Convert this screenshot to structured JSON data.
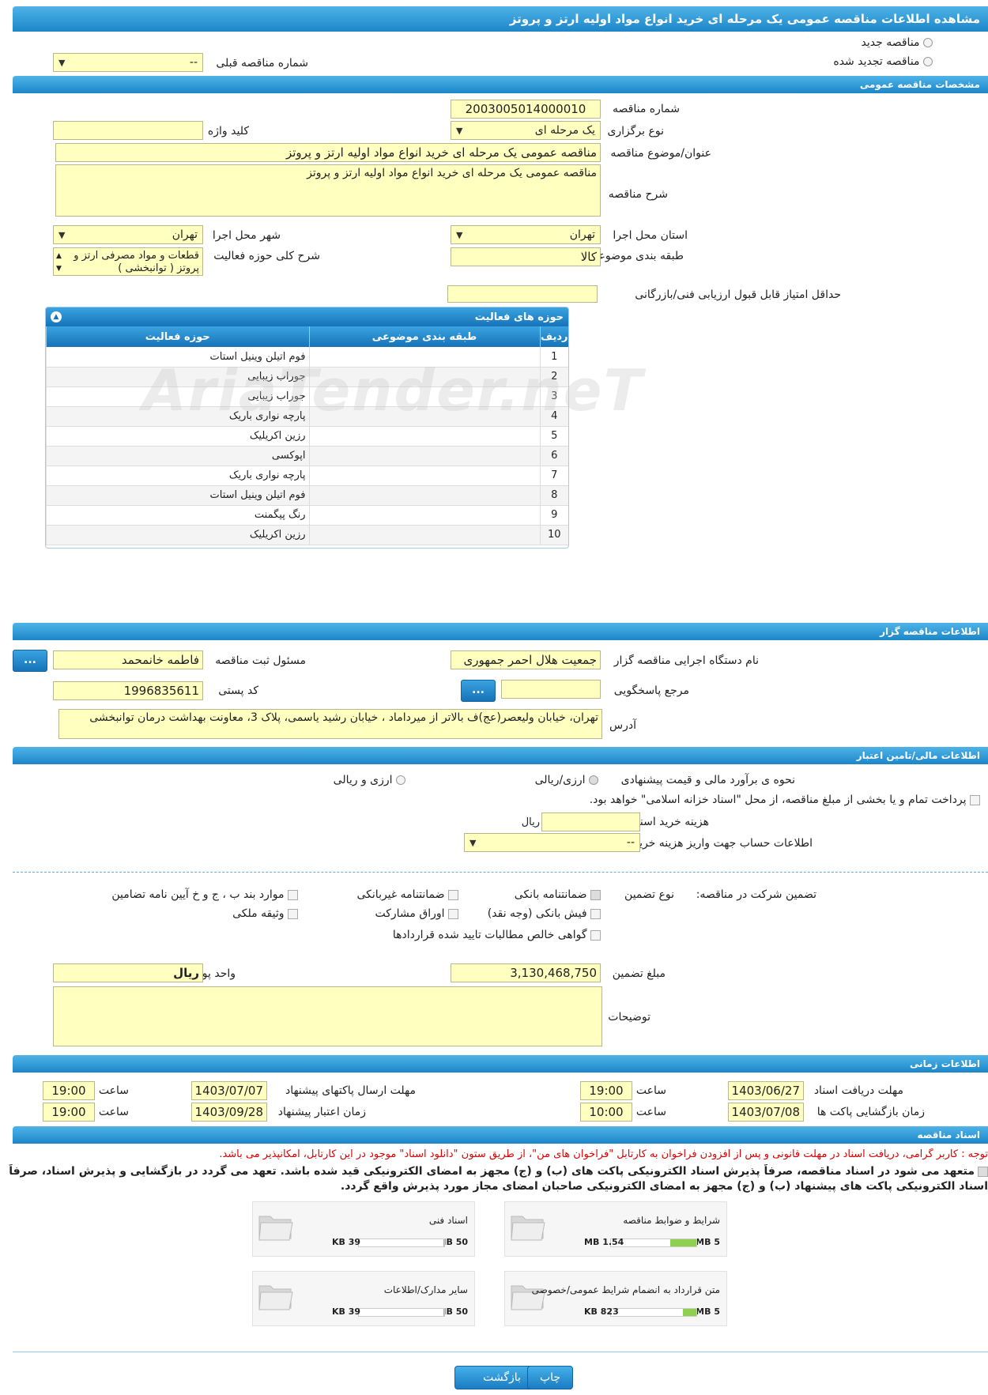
{
  "header": {
    "title": "مشاهده اطلاعات مناقصه عمومی یک مرحله ای خرید انواع مواد اولیه ارتز و پروتز"
  },
  "top": {
    "new_tender": "مناقصه جدید",
    "renewed_tender": "مناقصه تجدید شده",
    "prev_number_label": "شماره مناقصه قبلی",
    "prev_number_value": "--"
  },
  "general": {
    "section_title": "مشخصات مناقصه عمومی",
    "number_label": "شماره مناقصه",
    "number_value": "2003005014000010",
    "type_label": "نوع برگزاری",
    "type_value": "یک مرحله ای",
    "keyword_label": "کلید واژه",
    "keyword_value": "",
    "subject_label": "عنوان/موضوع مناقصه",
    "subject_value": "مناقصه عمومی یک مرحله ای خرید انواع مواد اولیه ارتز و پروتز",
    "desc_label": "شرح مناقصه",
    "desc_value": "مناقصه عمومی یک مرحله ای خرید انواع مواد اولیه ارتز و پروتز",
    "province_label": "استان محل اجرا",
    "province_value": "تهران",
    "city_label": "شهر محل اجرا",
    "city_value": "تهران",
    "category_label": "طبقه بندی موضوعی",
    "category_value": "کالا",
    "scope_label": "شرح کلی حوزه فعالیت",
    "scope_value": "قطعات و مواد مصرفی ارتز و پروتز ( توانبخشی )",
    "min_score_label": "حداقل امتیاز قابل قبول ارزیابی فنی/بازرگانی",
    "min_score_value": ""
  },
  "activities": {
    "title": "حوزه های فعالیت",
    "col_row": "ردیف",
    "col_category": "طبقه بندی موضوعی",
    "col_activity": "حوزه فعالیت",
    "rows": [
      {
        "n": "1",
        "cat": "",
        "act": "فوم اتیلن وینیل استات"
      },
      {
        "n": "2",
        "cat": "",
        "act": "جوراب زیبایی"
      },
      {
        "n": "3",
        "cat": "",
        "act": "جوراب زیبایی"
      },
      {
        "n": "4",
        "cat": "",
        "act": "پارچه  نواری باریک"
      },
      {
        "n": "5",
        "cat": "",
        "act": "رزین اکریلیک"
      },
      {
        "n": "6",
        "cat": "",
        "act": "اپوکسی"
      },
      {
        "n": "7",
        "cat": "",
        "act": "پارچه  نواری باریک"
      },
      {
        "n": "8",
        "cat": "",
        "act": "فوم اتیلن وینیل استات"
      },
      {
        "n": "9",
        "cat": "",
        "act": "رنگ پیگمنت"
      },
      {
        "n": "10",
        "cat": "",
        "act": "رزین اکریلیک"
      }
    ]
  },
  "org": {
    "section_title": "اطلاعات مناقصه گزار",
    "agency_label": "نام دستگاه اجرایی مناقصه گزار",
    "agency_value": "جمعیت هلال احمر جمهوری",
    "registrar_label": "مسئول ثبت مناقصه",
    "registrar_value": "فاطمه خانمحمد",
    "ref_label": "مرجع پاسخگویی",
    "ref_value": "",
    "postal_label": "کد پستی",
    "postal_value": "1996835611",
    "address_label": "آدرس",
    "address_value": "تهران، خیابان ولیعصر(عج)ف بالاتر از میرداماد ، خیابان رشید یاسمی، پلاک 3، معاونت بهداشت درمان توانبخشی",
    "btn": "..."
  },
  "finance": {
    "section_title": "اطلاعات مالی/تامین اعتبار",
    "estimate_label": "نحوه ی برآورد مالی و قیمت پیشنهادی",
    "opt1": "ارزی/ریالی",
    "opt2": "ارزی و ریالی",
    "treasury_text": "پرداخت تمام و یا بخشی از مبلغ مناقصه، از محل \"اسناد خزانه اسلامی\" خواهد بود.",
    "doc_cost_label": "هزینه خرید اسناد",
    "doc_cost_value": "",
    "currency": "ریال",
    "account_label": "اطلاعات حساب جهت واریز هزینه خرید اسناد",
    "account_value": "--"
  },
  "guarantee": {
    "label": "تضمین شرکت در مناقصه:",
    "type_label": "نوع تضمین",
    "bank": "ضمانتنامه بانکی",
    "nonbank": "ضمانتنامه غیربانکی",
    "clauses": "موارد بند ب ، ج و خ آیین نامه تضامین",
    "cash": "فیش بانکی (وجه نقد)",
    "bonds": "اوراق مشارکت",
    "property": "وثیقه ملکی",
    "receivables": "گواهی خالص مطالبات تایید شده قراردادها",
    "amount_label": "مبلغ تضمین",
    "amount_value": "3,130,468,750",
    "unit_label": "واحد پول",
    "unit_value": "ریال",
    "notes_label": "توضیحات",
    "notes_value": ""
  },
  "timing": {
    "section_title": "اطلاعات زمانی",
    "receive_label": "مهلت دریافت اسناد",
    "receive_date": "1403/06/27",
    "receive_time": "19:00",
    "send_label": "مهلت ارسال پاکتهای پیشنهاد",
    "send_date": "1403/07/07",
    "send_time": "19:00",
    "open_label": "زمان بازگشایی پاکت ها",
    "open_date": "1403/07/08",
    "open_time": "10:00",
    "valid_label": "زمان اعتبار پیشنهاد",
    "valid_date": "1403/09/28",
    "valid_time": "19:00",
    "time_label": "ساعت"
  },
  "docs": {
    "section_title": "اسناد مناقصه",
    "notice": "توجه : کاربر گرامی، دریافت اسناد در مهلت قانونی و پس از افزودن فراخوان به کارتابل \"فراخوان های من\"، از طریق ستون \"دانلود اسناد\" موجود در این کارتابل، امکانپذیر می باشد.",
    "commit": "متعهد می شود در اسناد مناقصه، صرفاً پذیرش اسناد الکترونیکی پاکت های (ب) و (ج) مجهز به امضای الکترونیکی قید شده باشد. تعهد می گردد در بازگشایی و پذیرش اسناد، صرفاً اسناد الکترونیکی پاکت های پیشنهاد (ب) و (ج) مجهز به امضای الکترونیکی صاحبان امضای مجاز مورد پذیرش واقع گردد.",
    "files": [
      {
        "title": "شرایط و ضوابط مناقصه",
        "size": "1.54 MB",
        "max": "5 MB",
        "fill": 0.31
      },
      {
        "title": "اسناد فنی",
        "size": "39 KB",
        "max": "50 MB",
        "fill": 0.01
      },
      {
        "title": "متن قرارداد به انضمام شرایط عمومی/خصوصی",
        "size": "823 KB",
        "max": "5 MB",
        "fill": 0.16
      },
      {
        "title": "سایر مدارک/اطلاعات",
        "size": "39 KB",
        "max": "50 MB",
        "fill": 0.01
      }
    ]
  },
  "footer": {
    "back": "بازگشت",
    "print": "چاپ"
  },
  "watermark": "AriaTender.neT"
}
